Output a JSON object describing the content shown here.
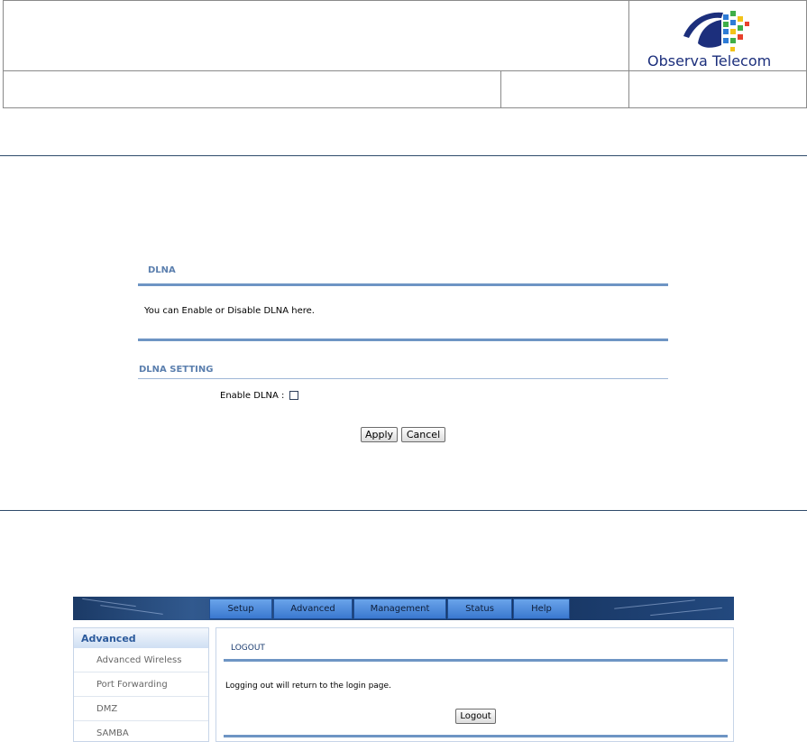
{
  "header": {
    "logo_text": "Observa Telecom",
    "logo_colors": [
      "#1c2f7c",
      "#2e7bd6",
      "#3fae49",
      "#f2c318",
      "#e8412c"
    ]
  },
  "dlna_panel": {
    "title": "DLNA",
    "description": "You can Enable or Disable DLNA here.",
    "setting_title": "DLNA SETTING",
    "enable_label": "Enable DLNA :",
    "enable_checked": false,
    "apply_label": "Apply",
    "cancel_label": "Cancel"
  },
  "router_ui": {
    "tabs": [
      "Setup",
      "Advanced",
      "Management",
      "Status",
      "Help"
    ],
    "sidebar": {
      "heading": "Advanced",
      "items": [
        "Advanced Wireless",
        "Port Forwarding",
        "DMZ",
        "SAMBA"
      ]
    },
    "logout": {
      "title": "LOGOUT",
      "description": "Logging out will return to the login page.",
      "button_label": "Logout"
    }
  }
}
